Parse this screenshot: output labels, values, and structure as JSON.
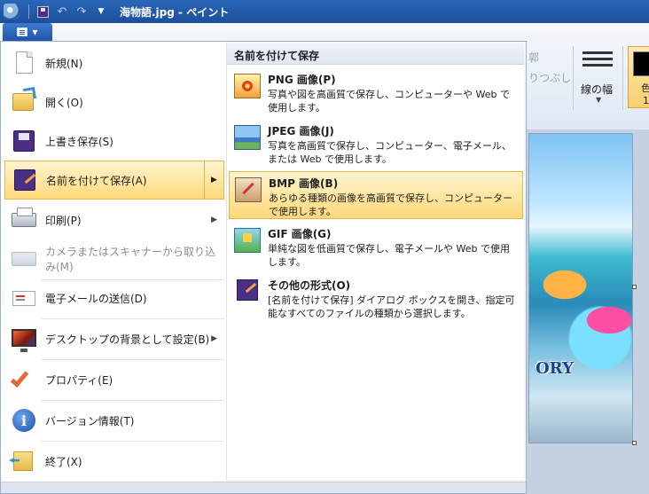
{
  "window": {
    "title": "海物語.jpg - ペイント"
  },
  "ribbon": {
    "partial_label_1": "郭",
    "partial_label_2": "りつぶし",
    "line_width_label": "線の幅",
    "color1_label": "色",
    "color1_number": "1",
    "image_text": "ORY"
  },
  "app_menu": {
    "items": [
      {
        "label": "新規(N)"
      },
      {
        "label": "開く(O)"
      },
      {
        "label": "上書き保存(S)"
      },
      {
        "label": "名前を付けて保存(A)"
      },
      {
        "label": "印刷(P)"
      },
      {
        "label": "カメラまたはスキャナーから取り込み(M)"
      },
      {
        "label": "電子メールの送信(D)"
      },
      {
        "label": "デスクトップの背景として設定(B)"
      },
      {
        "label": "プロパティ(E)"
      },
      {
        "label": "バージョン情報(T)"
      },
      {
        "label": "終了(X)"
      }
    ]
  },
  "save_as_panel": {
    "header": "名前を付けて保存",
    "formats": [
      {
        "title": "PNG 画像(P)",
        "description": "写真や図を高画質で保存し、コンピューターや Web で使用します。"
      },
      {
        "title": "JPEG 画像(J)",
        "description": "写真を高画質で保存し、コンピューター、電子メール、または Web で使用します。"
      },
      {
        "title": "BMP 画像(B)",
        "description": "あらゆる種類の画像を高画質で保存し、コンピューターで使用します。"
      },
      {
        "title": "GIF 画像(G)",
        "description": "単純な図を低画質で保存し、電子メールや Web で使用します。"
      },
      {
        "title": "その他の形式(O)",
        "description": "[名前を付けて保存] ダイアログ ボックスを開き、指定可能なすべてのファイルの種類から選択します。"
      }
    ]
  }
}
